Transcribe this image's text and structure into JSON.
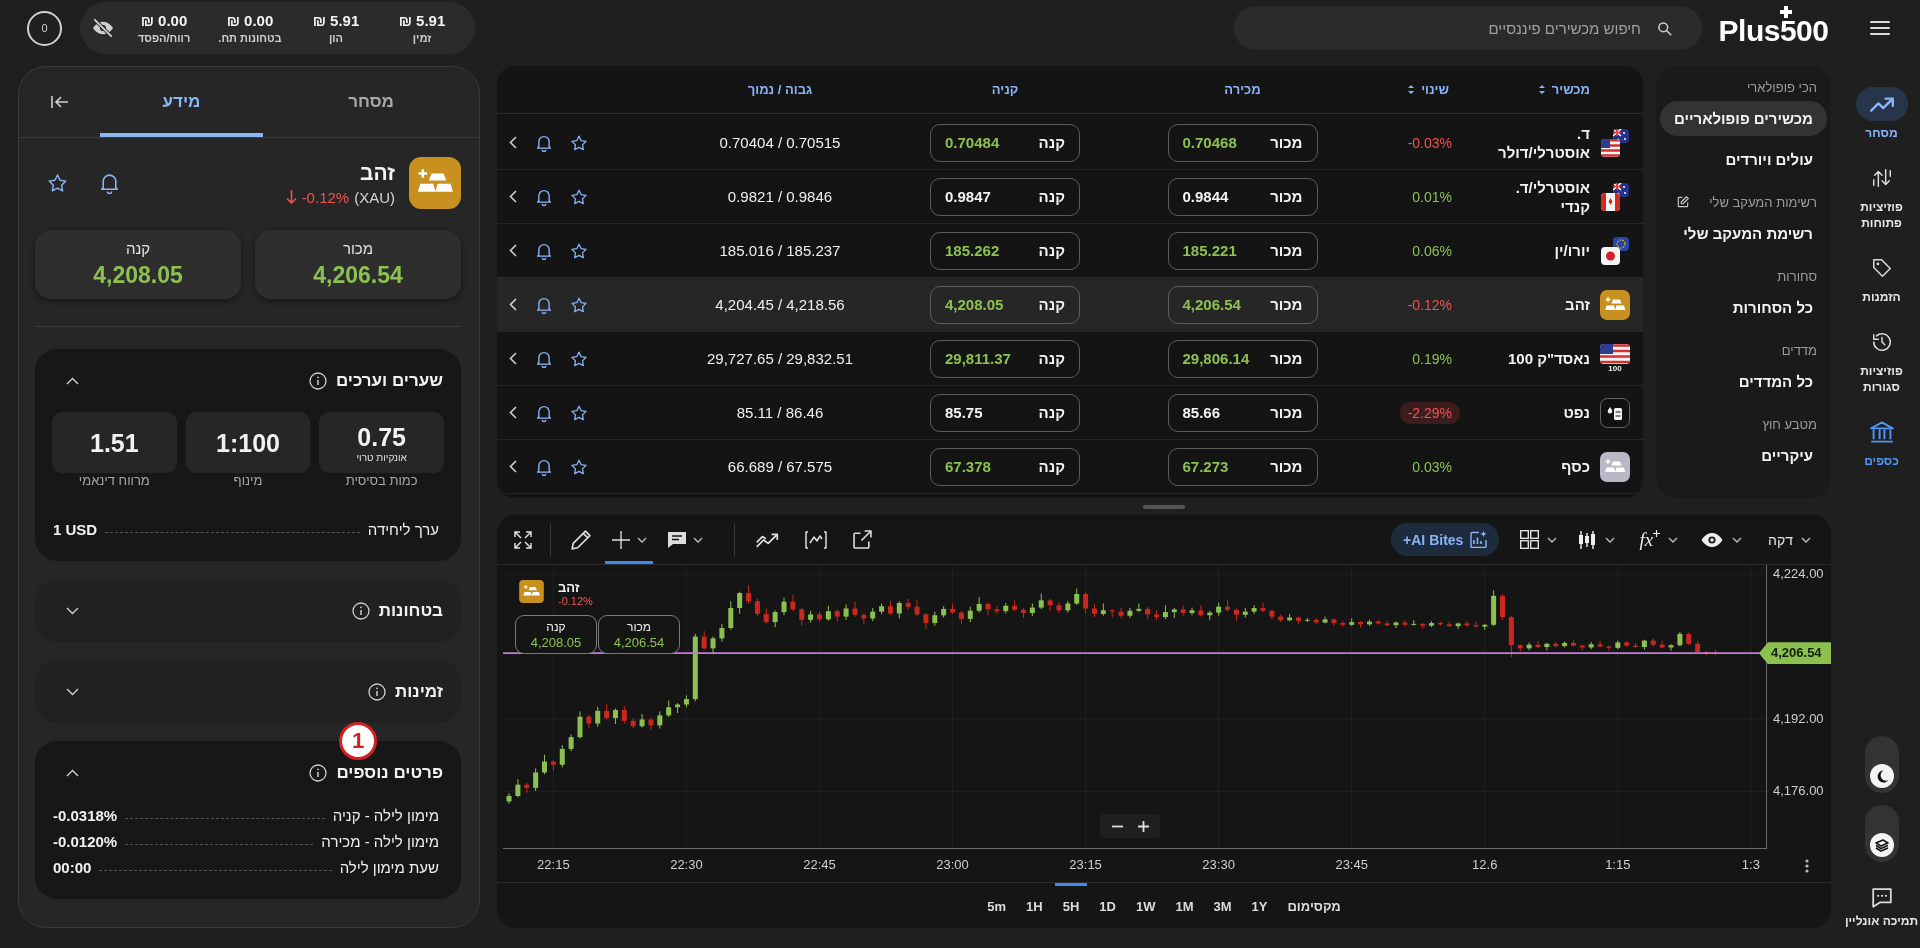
{
  "top_bar": {
    "logo": "Plus500",
    "search": {
      "placeholder": "חיפוש מכשירים פיננסיים"
    },
    "account": [
      {
        "label": "זמין",
        "value": "₪ 5.91"
      },
      {
        "label": "הון",
        "value": "₪ 5.91"
      },
      {
        "label": "בטחונות תח.",
        "value": "₪ 0.00"
      },
      {
        "label": "רווח/הפסד",
        "value": "₪ 0.00"
      }
    ],
    "notifications": "0"
  },
  "nav": {
    "items": [
      {
        "kind": "trading",
        "label": "מסחר",
        "selected": true,
        "highlighted": false
      },
      {
        "kind": "open",
        "label": "פוזיציות פתוחות",
        "selected": false,
        "highlighted": false
      },
      {
        "kind": "orders",
        "label": "הזמנות",
        "selected": false,
        "highlighted": false
      },
      {
        "kind": "closed",
        "label": "פוזיציות סגורות",
        "selected": false,
        "highlighted": false
      },
      {
        "kind": "funds",
        "label": "כספים",
        "selected": false,
        "highlighted": true
      }
    ],
    "support": "תמיכה אונליין"
  },
  "categories": [
    {
      "title": "הכי פופולארי",
      "editable": false,
      "items": [
        {
          "label": "מכשירים פופולאריים",
          "selected": true
        },
        {
          "label": "עולים ויורדים",
          "selected": false
        }
      ]
    },
    {
      "title": "רשימות המעקב שלי",
      "editable": true,
      "items": [
        {
          "label": "רשימת המעקב שלי",
          "selected": false
        }
      ]
    },
    {
      "title": "סחורות",
      "editable": false,
      "items": [
        {
          "label": "כל הסחורות",
          "selected": false
        }
      ]
    },
    {
      "title": "מדדים",
      "editable": false,
      "items": [
        {
          "label": "כל המדדים",
          "selected": false
        }
      ]
    },
    {
      "title": "מטבע חוץ",
      "editable": false,
      "items": [
        {
          "label": "עיקריים",
          "selected": false
        }
      ]
    }
  ],
  "instruments": {
    "columns": [
      {
        "label": "מכשיר",
        "sortable": true
      },
      {
        "label": "שינוי",
        "sortable": true
      },
      {
        "label": "מכירה",
        "sortable": false
      },
      {
        "label": "קניה",
        "sortable": false
      },
      {
        "label": "גבוה / נמוך",
        "sortable": false
      }
    ],
    "rows": [
      {
        "kind": "audusd",
        "name": "ד. אוסטרלי/דולר",
        "change": "-0.03%",
        "negative": true,
        "highlight": false,
        "sell_label": "מכור",
        "sell": "0.70468",
        "buy_label": "קנה",
        "buy": "0.70484",
        "rising": true,
        "high_low": "0.70404 / 0.70515",
        "selected": false
      },
      {
        "kind": "audcad",
        "name": "אוסטרלי/ד. קנדי",
        "change": "0.01%",
        "negative": false,
        "highlight": false,
        "sell_label": "מכור",
        "sell": "0.9844",
        "buy_label": "קנה",
        "buy": "0.9847",
        "rising": false,
        "high_low": "0.9821 / 0.9846",
        "selected": false
      },
      {
        "kind": "eurjpy",
        "name": "יורו/ין",
        "change": "0.06%",
        "negative": false,
        "highlight": false,
        "sell_label": "מכור",
        "sell": "185.221",
        "buy_label": "קנה",
        "buy": "185.262",
        "rising": true,
        "high_low": "185.016 / 185.237",
        "selected": false
      },
      {
        "kind": "gold",
        "name": "זהב",
        "change": "-0.12%",
        "negative": true,
        "highlight": false,
        "sell_label": "מכור",
        "sell": "4,206.54",
        "buy_label": "קנה",
        "buy": "4,208.05",
        "rising": true,
        "high_low": "4,204.45 / 4,218.56",
        "selected": true
      },
      {
        "kind": "index",
        "icon_label": "100",
        "name": "נאסד\"ק 100",
        "change": "0.19%",
        "negative": false,
        "highlight": false,
        "sell_label": "מכור",
        "sell": "29,806.14",
        "buy_label": "קנה",
        "buy": "29,811.37",
        "rising": true,
        "high_low": "29,727.65 / 29,832.51",
        "selected": false
      },
      {
        "kind": "oil",
        "name": "נפט",
        "change": "-2.29%",
        "negative": true,
        "highlight": true,
        "sell_label": "מכור",
        "sell": "85.66",
        "buy_label": "קנה",
        "buy": "85.75",
        "rising": false,
        "high_low": "85.11 / 86.46",
        "selected": false
      },
      {
        "kind": "silver",
        "name": "כסף",
        "change": "0.03%",
        "negative": false,
        "highlight": false,
        "sell_label": "מכור",
        "sell": "67.273",
        "buy_label": "קנה",
        "buy": "67.378",
        "rising": true,
        "high_low": "66.689 / 67.575",
        "selected": false
      }
    ]
  },
  "chart": {
    "interval": "דקה",
    "functions": "fx",
    "ai_button": "+AI Bites",
    "tools": [
      {
        "kind": "pencil",
        "selected": false,
        "menu": false
      },
      {
        "kind": "crosshair",
        "selected": true,
        "menu": true
      },
      {
        "kind": "note",
        "selected": false,
        "menu": true
      }
    ],
    "legend": {
      "name": "זהב",
      "change": "-0.12%",
      "negative": true
    },
    "quotes": [
      {
        "label": "מכור",
        "value": "4,206.54"
      },
      {
        "label": "קנה",
        "value": "4,208.05"
      }
    ],
    "chart_data": {
      "type": "candlestick",
      "categories": [
        null,
        null,
        null,
        null,
        null,
        "22:15",
        null,
        null,
        null,
        null,
        null,
        null,
        null,
        null,
        null,
        null,
        null,
        null,
        null,
        null,
        "22:30",
        null,
        null,
        null,
        null,
        null,
        null,
        null,
        null,
        null,
        null,
        null,
        null,
        null,
        null,
        "22:45",
        null,
        null,
        null,
        null,
        null,
        null,
        null,
        null,
        null,
        null,
        null,
        null,
        null,
        null,
        "23:00",
        null,
        null,
        null,
        null,
        null,
        null,
        null,
        null,
        null,
        null,
        null,
        null,
        null,
        null,
        "23:15",
        null,
        null,
        null,
        null,
        null,
        null,
        null,
        null,
        null,
        null,
        null,
        null,
        null,
        null,
        "23:30",
        null,
        null,
        null,
        null,
        null,
        null,
        null,
        null,
        null,
        null,
        null,
        null,
        null,
        null,
        "23:45",
        null,
        null,
        null,
        null,
        null,
        null,
        null,
        null,
        null,
        null,
        null,
        null,
        null,
        null,
        "12.6",
        null,
        null,
        null,
        null,
        null,
        null,
        null,
        null,
        null,
        null,
        null,
        null,
        null,
        null,
        "1:15",
        null,
        null,
        null,
        null,
        null,
        null,
        null,
        null,
        null,
        null,
        null,
        null,
        null,
        null,
        "1:3"
      ],
      "ohlc": [
        [
          4173.8,
          4175.6,
          4173.3,
          4175.0
        ],
        [
          4175.0,
          4178.7,
          4174.7,
          4177.5
        ],
        [
          4177.5,
          4177.9,
          4175.7,
          4176.8
        ],
        [
          4176.8,
          4181.1,
          4176.1,
          4180.2
        ],
        [
          4180.2,
          4184.1,
          4179.8,
          4182.6
        ],
        [
          4182.6,
          4182.9,
          4180.6,
          4181.9
        ],
        [
          4181.9,
          4186.2,
          4181.3,
          4185.4
        ],
        [
          4185.4,
          4188.6,
          4184.9,
          4188.0
        ],
        [
          4188.0,
          4193.7,
          4187.7,
          4192.5
        ],
        [
          4192.5,
          4192.9,
          4189.9,
          4191.0
        ],
        [
          4191.0,
          4194.7,
          4190.3,
          4193.8
        ],
        [
          4193.8,
          4195.3,
          4191.8,
          4192.2
        ],
        [
          4192.2,
          4194.3,
          4190.9,
          4194.0
        ],
        [
          4194.0,
          4194.8,
          4191.0,
          4191.6
        ],
        [
          4191.6,
          4192.2,
          4189.9,
          4190.4
        ],
        [
          4190.4,
          4193.1,
          4190.1,
          4191.9
        ],
        [
          4191.9,
          4192.3,
          4189.5,
          4190.6
        ],
        [
          4190.6,
          4193.7,
          4189.9,
          4192.8
        ],
        [
          4192.8,
          4196.1,
          4192.4,
          4194.6
        ],
        [
          4194.6,
          4195.5,
          4193.3,
          4195.2
        ],
        [
          4195.2,
          4197.2,
          4194.6,
          4196.4
        ],
        [
          4196.4,
          4210.8,
          4195.9,
          4210.2
        ],
        [
          4210.2,
          4211.4,
          4207.3,
          4207.6
        ],
        [
          4207.6,
          4210.2,
          4206.5,
          4209.8
        ],
        [
          4209.8,
          4213.0,
          4209.1,
          4212.1
        ],
        [
          4212.1,
          4218.0,
          4211.7,
          4216.5
        ],
        [
          4216.5,
          4220.1,
          4215.2,
          4219.8
        ],
        [
          4219.8,
          4221.6,
          4217.4,
          4218.0
        ],
        [
          4218.0,
          4218.6,
          4214.7,
          4215.2
        ],
        [
          4215.2,
          4216.4,
          4213.1,
          4213.4
        ],
        [
          4213.4,
          4216.0,
          4212.3,
          4215.6
        ],
        [
          4215.6,
          4218.8,
          4214.9,
          4217.9
        ],
        [
          4217.9,
          4219.4,
          4215.8,
          4216.2
        ],
        [
          4216.2,
          4216.5,
          4212.6,
          4213.9
        ],
        [
          4213.9,
          4215.9,
          4213.3,
          4215.1
        ],
        [
          4215.1,
          4215.7,
          4213.5,
          4214.0
        ],
        [
          4214.0,
          4217.0,
          4213.7,
          4215.8
        ],
        [
          4215.8,
          4216.2,
          4213.5,
          4214.6
        ],
        [
          4214.6,
          4217.3,
          4213.9,
          4216.4
        ],
        [
          4216.4,
          4217.9,
          4214.6,
          4215.0
        ],
        [
          4215.0,
          4215.3,
          4212.9,
          4214.2
        ],
        [
          4214.2,
          4216.5,
          4213.6,
          4215.7
        ],
        [
          4215.7,
          4217.5,
          4215.2,
          4216.9
        ],
        [
          4216.9,
          4218.1,
          4215.0,
          4215.3
        ],
        [
          4215.3,
          4218.0,
          4214.2,
          4217.6
        ],
        [
          4217.6,
          4218.5,
          4216.1,
          4216.8
        ],
        [
          4216.8,
          4218.3,
          4214.7,
          4215.1
        ],
        [
          4215.1,
          4215.4,
          4211.9,
          4213.2
        ],
        [
          4213.2,
          4215.7,
          4212.6,
          4214.9
        ],
        [
          4214.9,
          4216.9,
          4214.4,
          4216.3
        ],
        [
          4216.3,
          4217.5,
          4215.2,
          4215.5
        ],
        [
          4215.5,
          4215.9,
          4213.0,
          4214.1
        ],
        [
          4214.1,
          4216.8,
          4213.4,
          4215.9
        ],
        [
          4215.9,
          4218.9,
          4215.5,
          4217.4
        ],
        [
          4217.4,
          4217.7,
          4214.9,
          4216.2
        ],
        [
          4216.2,
          4217.0,
          4215.2,
          4215.8
        ],
        [
          4215.8,
          4217.6,
          4215.3,
          4217.0
        ],
        [
          4217.0,
          4218.2,
          4215.8,
          4216.1
        ],
        [
          4216.1,
          4216.5,
          4214.3,
          4215.4
        ],
        [
          4215.4,
          4217.5,
          4214.7,
          4216.6
        ],
        [
          4216.6,
          4219.7,
          4216.2,
          4218.2
        ],
        [
          4218.2,
          4218.5,
          4215.8,
          4217.1
        ],
        [
          4217.1,
          4217.9,
          4215.4,
          4216.0
        ],
        [
          4216.0,
          4218.1,
          4215.5,
          4217.5
        ],
        [
          4217.5,
          4220.8,
          4217.2,
          4219.6
        ],
        [
          4219.6,
          4220.0,
          4215.3,
          4216.4
        ],
        [
          4216.4,
          4217.3,
          4214.5,
          4215.2
        ],
        [
          4215.2,
          4217.5,
          4214.8,
          4216.0
        ],
        [
          4216.0,
          4216.3,
          4214.4,
          4215.7
        ],
        [
          4215.7,
          4216.5,
          4214.2,
          4214.8
        ],
        [
          4214.8,
          4216.5,
          4214.3,
          4215.9
        ],
        [
          4215.9,
          4217.5,
          4215.6,
          4216.3
        ],
        [
          4216.3,
          4216.7,
          4214.0,
          4215.1
        ],
        [
          4215.1,
          4216.0,
          4213.8,
          4214.5
        ],
        [
          4214.5,
          4217.1,
          4214.1,
          4215.6
        ],
        [
          4215.6,
          4216.5,
          4214.3,
          4216.2
        ],
        [
          4216.2,
          4217.0,
          4214.8,
          4215.4
        ],
        [
          4215.4,
          4216.6,
          4214.9,
          4216.0
        ],
        [
          4216.0,
          4217.2,
          4214.6,
          4214.9
        ],
        [
          4214.9,
          4215.9,
          4213.8,
          4215.5
        ],
        [
          4215.5,
          4217.7,
          4214.8,
          4216.8
        ],
        [
          4216.8,
          4218.3,
          4215.7,
          4216.1
        ],
        [
          4216.1,
          4216.4,
          4213.7,
          4215.0
        ],
        [
          4215.0,
          4216.5,
          4214.4,
          4215.7
        ],
        [
          4215.7,
          4217.1,
          4215.2,
          4216.5
        ],
        [
          4216.5,
          4217.7,
          4215.6,
          4215.9
        ],
        [
          4215.9,
          4216.1,
          4214.0,
          4214.6
        ],
        [
          4214.6,
          4215.1,
          4213.4,
          4213.8
        ],
        [
          4213.8,
          4215.2,
          4213.6,
          4214.4
        ],
        [
          4214.4,
          4214.6,
          4213.0,
          4213.7
        ],
        [
          4213.7,
          4214.3,
          4213.4,
          4213.9
        ],
        [
          4213.9,
          4214.2,
          4213.0,
          4213.3
        ],
        [
          4213.3,
          4214.6,
          4213.1,
          4214.0
        ],
        [
          4214.0,
          4214.2,
          4212.6,
          4213.2
        ],
        [
          4213.2,
          4213.7,
          4212.4,
          4212.8
        ],
        [
          4212.8,
          4214.2,
          4212.6,
          4213.4
        ],
        [
          4213.4,
          4213.6,
          4212.2,
          4212.9
        ],
        [
          4212.9,
          4213.9,
          4212.6,
          4213.5
        ],
        [
          4213.5,
          4213.8,
          4212.8,
          4213.1
        ],
        [
          4213.1,
          4213.7,
          4212.5,
          4212.7
        ],
        [
          4212.7,
          4213.5,
          4212.1,
          4213.3
        ],
        [
          4213.3,
          4213.8,
          4212.4,
          4212.8
        ],
        [
          4212.8,
          4213.8,
          4212.6,
          4213.0
        ],
        [
          4213.0,
          4213.2,
          4211.9,
          4212.6
        ],
        [
          4212.6,
          4213.6,
          4212.3,
          4213.2
        ],
        [
          4213.2,
          4213.5,
          4212.6,
          4212.9
        ],
        [
          4212.9,
          4213.5,
          4212.3,
          4212.5
        ],
        [
          4212.5,
          4213.3,
          4211.9,
          4213.1
        ],
        [
          4213.1,
          4213.6,
          4212.3,
          4212.7
        ],
        [
          4212.7,
          4213.5,
          4212.2,
          4212.4
        ],
        [
          4212.4,
          4213.0,
          4211.7,
          4212.8
        ],
        [
          4212.8,
          4220.4,
          4212.5,
          4219.2
        ],
        [
          4219.2,
          4219.6,
          4213.9,
          4214.5
        ],
        [
          4214.5,
          4214.8,
          4205.6,
          4208.3
        ],
        [
          4208.3,
          4208.5,
          4207.0,
          4207.6
        ],
        [
          4207.6,
          4208.9,
          4207.2,
          4208.4
        ],
        [
          4208.4,
          4209.2,
          4207.7,
          4207.9
        ],
        [
          4207.9,
          4208.8,
          4207.2,
          4208.6
        ],
        [
          4208.6,
          4209.0,
          4207.8,
          4208.1
        ],
        [
          4208.1,
          4209.1,
          4207.8,
          4208.8
        ],
        [
          4208.8,
          4209.4,
          4208.0,
          4208.2
        ],
        [
          4208.2,
          4208.4,
          4207.2,
          4207.8
        ],
        [
          4207.8,
          4209.0,
          4207.4,
          4208.5
        ],
        [
          4208.5,
          4209.3,
          4207.8,
          4208.0
        ],
        [
          4208.0,
          4208.2,
          4207.0,
          4207.7
        ],
        [
          4207.7,
          4209.3,
          4207.4,
          4208.9
        ],
        [
          4208.9,
          4209.2,
          4207.9,
          4208.2
        ],
        [
          4208.2,
          4208.8,
          4207.7,
          4207.9
        ],
        [
          4207.9,
          4209.5,
          4207.3,
          4209.3
        ],
        [
          4209.3,
          4209.8,
          4208.0,
          4208.4
        ],
        [
          4208.4,
          4209.2,
          4207.6,
          4207.8
        ],
        [
          4207.8,
          4208.5,
          4207.1,
          4208.3
        ],
        [
          4208.3,
          4211.2,
          4208.0,
          4210.8
        ],
        [
          4210.8,
          4211.1,
          4208.3,
          4208.6
        ],
        [
          4208.6,
          4209.2,
          4206.6,
          4206.8
        ],
        [
          4206.8,
          4207.0,
          4206.1,
          4206.7
        ],
        [
          4206.7,
          4207.2,
          4206.1,
          4206.54
        ],
        null,
        null,
        null,
        null
      ],
      "ylim": [
        4163.3,
        4226.0
      ],
      "yticks": [
        {
          "value": 4224,
          "label": "4,224.00"
        },
        {
          "value": 4192,
          "label": "4,192.00"
        },
        {
          "value": 4176,
          "label": "4,176.00"
        }
      ],
      "ref_lines": [
        {
          "axis": "y",
          "value": 4206.54,
          "label": "4,206.54",
          "color": "#c47ad6"
        }
      ]
    },
    "periods": [
      {
        "label": "מקסימום",
        "selected": false
      },
      {
        "label": "1Y",
        "selected": false
      },
      {
        "label": "3M",
        "selected": false
      },
      {
        "label": "1M",
        "selected": false
      },
      {
        "label": "1W",
        "selected": false
      },
      {
        "label": "1D",
        "selected": false
      },
      {
        "label": "5H",
        "selected": true
      },
      {
        "label": "1H",
        "selected": false
      },
      {
        "label": "5m",
        "selected": false
      }
    ]
  },
  "details": {
    "tabs": [
      {
        "label": "מסחר",
        "selected": false
      },
      {
        "label": "מידע",
        "selected": true
      }
    ],
    "instrument": {
      "name": "זהב",
      "symbol": "(XAU)",
      "change": "-0.12%",
      "negative": true
    },
    "quotes": [
      {
        "label": "מכור",
        "value": "4,206.54"
      },
      {
        "label": "קנה",
        "value": "4,208.05"
      }
    ],
    "sections": [
      {
        "title": "שערים וערכים",
        "expanded": true,
        "tiles": [
          {
            "value": "0.75",
            "unit": "אונקיות טרוי",
            "label": "כמות בסיסית"
          },
          {
            "value": "1:100",
            "label": "מינוף"
          },
          {
            "value": "1.51",
            "label": "מרווח דינאמי"
          }
        ],
        "rows": [
          {
            "label": "ערך ליחידה",
            "value": "1 USD"
          }
        ]
      },
      {
        "title": "בטחונות",
        "expanded": false
      },
      {
        "title": "זמינות",
        "expanded": false
      },
      {
        "title": "פרטים נוספים",
        "expanded": true,
        "callout": "1",
        "rows": [
          {
            "label": "מימון לילה - קניה",
            "value": "-0.0318%"
          },
          {
            "label": "מימון לילה - מכירה",
            "value": "-0.0120%"
          },
          {
            "label": "שעת מימון לילה",
            "value": "00:00"
          }
        ]
      }
    ]
  }
}
